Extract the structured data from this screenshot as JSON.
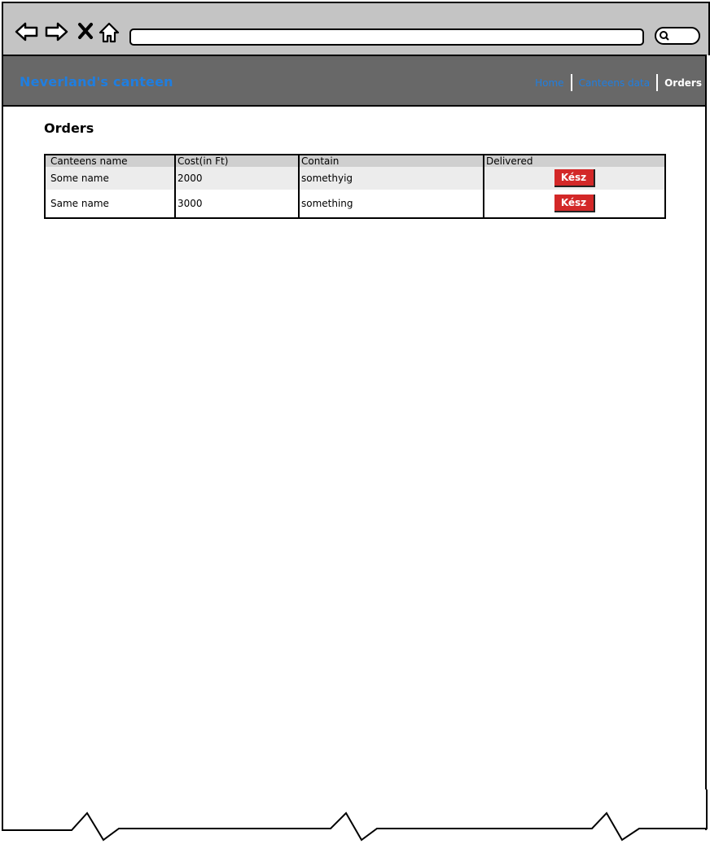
{
  "header": {
    "brand": "Neverland's canteen",
    "nav": {
      "home": "Home",
      "canteens_data": "Canteens data",
      "orders": "Orders"
    }
  },
  "main": {
    "title": "Orders",
    "table": {
      "columns": [
        "Canteens name",
        "Cost(in Ft)",
        "Contain",
        "Delivered"
      ],
      "rows": [
        {
          "name": "Some name",
          "cost": "2000",
          "contain": "somethyig",
          "button": "Kész"
        },
        {
          "name": "Same name",
          "cost": "3000",
          "contain": "something",
          "button": "Kész"
        }
      ]
    }
  },
  "colors": {
    "brand": "#1f7ee0",
    "header_bg": "#686868",
    "button": "#d32828"
  },
  "icons": [
    "back-arrow-icon",
    "forward-arrow-icon",
    "close-icon",
    "home-icon",
    "search-icon"
  ]
}
